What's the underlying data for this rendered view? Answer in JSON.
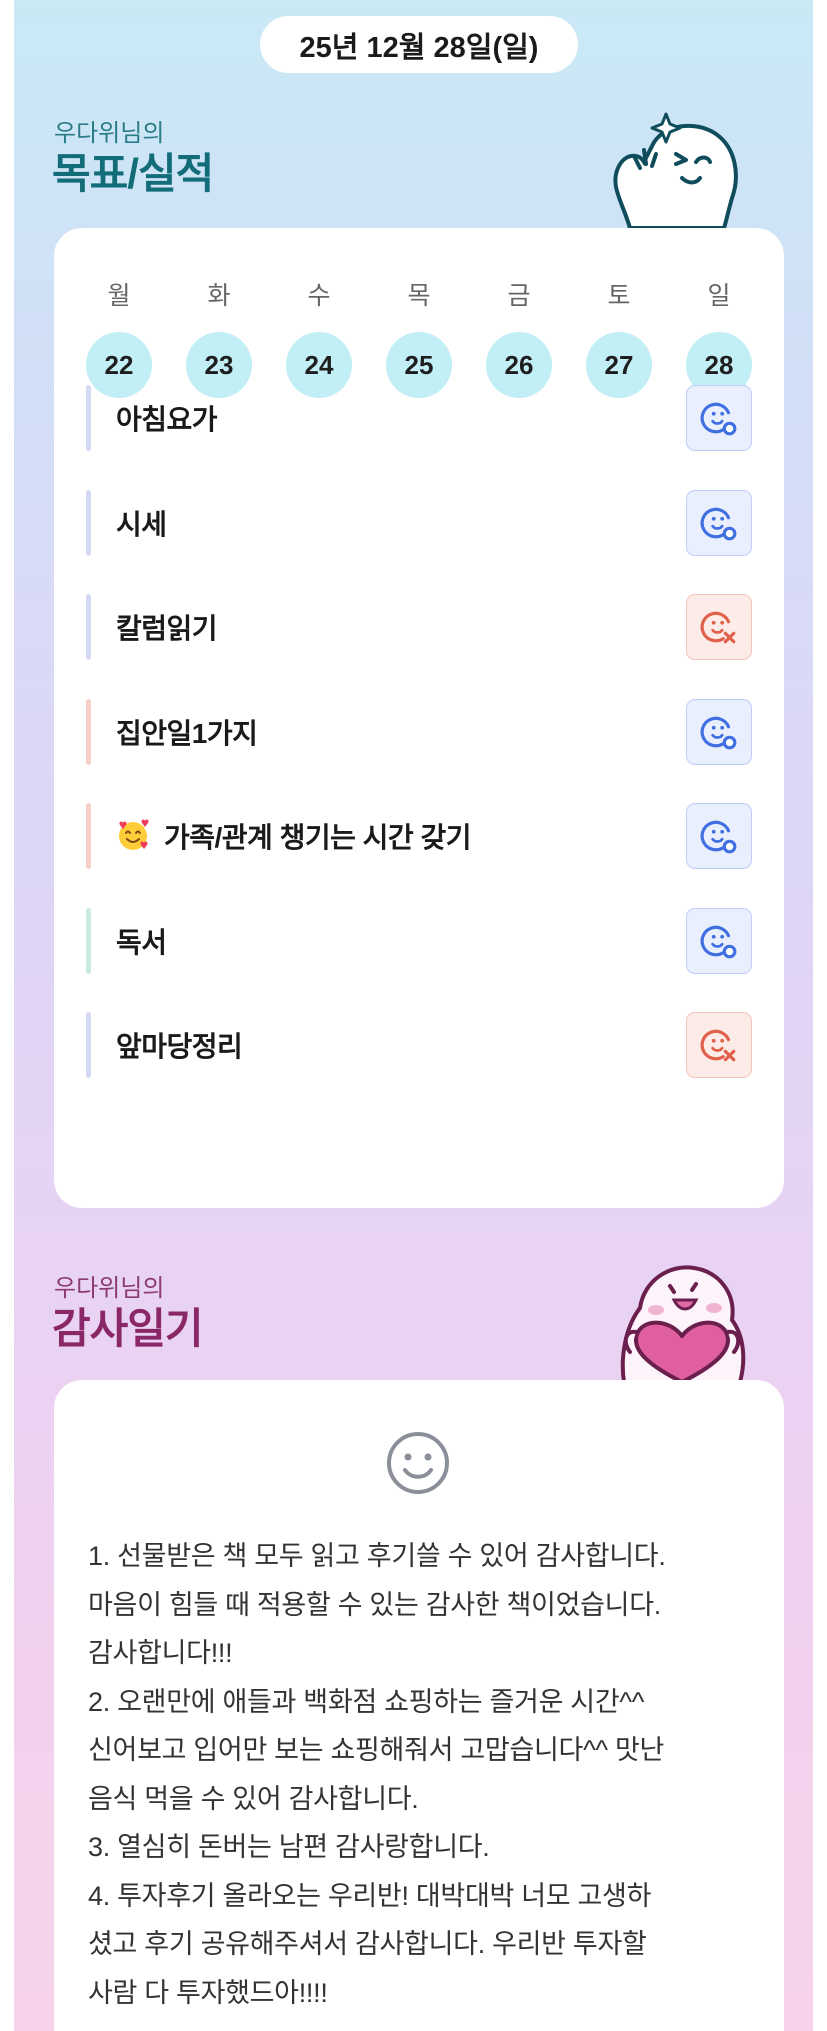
{
  "header": {
    "date": "25년 12월 28일(일)"
  },
  "goals_section": {
    "subtitle": "우다위님의",
    "title": "목표/실적"
  },
  "week": {
    "weekdays": [
      "월",
      "화",
      "수",
      "목",
      "금",
      "토",
      "일"
    ],
    "days": [
      "22",
      "23",
      "24",
      "25",
      "26",
      "27",
      "28"
    ]
  },
  "goals": [
    {
      "label": "아침요가",
      "status": "done",
      "bar_color": "#d4daf4"
    },
    {
      "label": "시세",
      "status": "done",
      "bar_color": "#d4daf4"
    },
    {
      "label": "칼럼읽기",
      "status": "missed",
      "bar_color": "#d4daf4"
    },
    {
      "label": "집안일1가지",
      "status": "done",
      "bar_color": "#f5cfc8"
    },
    {
      "label": "가족/관계 챙기는 시간 갖기",
      "status": "done",
      "bar_color": "#f5cfc8",
      "emoji": "smiling-face-with-hearts-icon"
    },
    {
      "label": "독서",
      "status": "done",
      "bar_color": "#c8eadf"
    },
    {
      "label": "앞마당정리",
      "status": "missed",
      "bar_color": "#d4daf4"
    }
  ],
  "gratitude_section": {
    "subtitle": "우다위님의",
    "title": "감사일기",
    "icon": "smiley-icon",
    "lines": [
      "1. 선물받은 책 모두 읽고 후기쓸 수 있어 감사합니다.",
      "마음이 힘들 때 적용할 수 있는 감사한 책이었습니다.",
      "감사합니다!!!",
      "2. 오랜만에 애들과 백화점 쇼핑하는 즐거운 시간^^",
      "신어보고 입어만 보는 쇼핑해줘서 고맙습니다^^ 맛난",
      "음식 먹을 수 있어 감사합니다.",
      "3. 열심히 돈버는 남편 감사랑합니다.",
      "4. 투자후기 올라오는 우리반! 대박대박 너모 고생하",
      "셨고 후기 공유해주셔서 감사합니다. 우리반 투자할",
      "사람 다 투자했드아!!!!"
    ]
  },
  "colors": {
    "success_icon": "#3f6fe0",
    "fail_icon": "#e0604a",
    "day_circle": "#c2eef6",
    "goal_title": "#136d78",
    "gratitude_title": "#8a2867"
  }
}
